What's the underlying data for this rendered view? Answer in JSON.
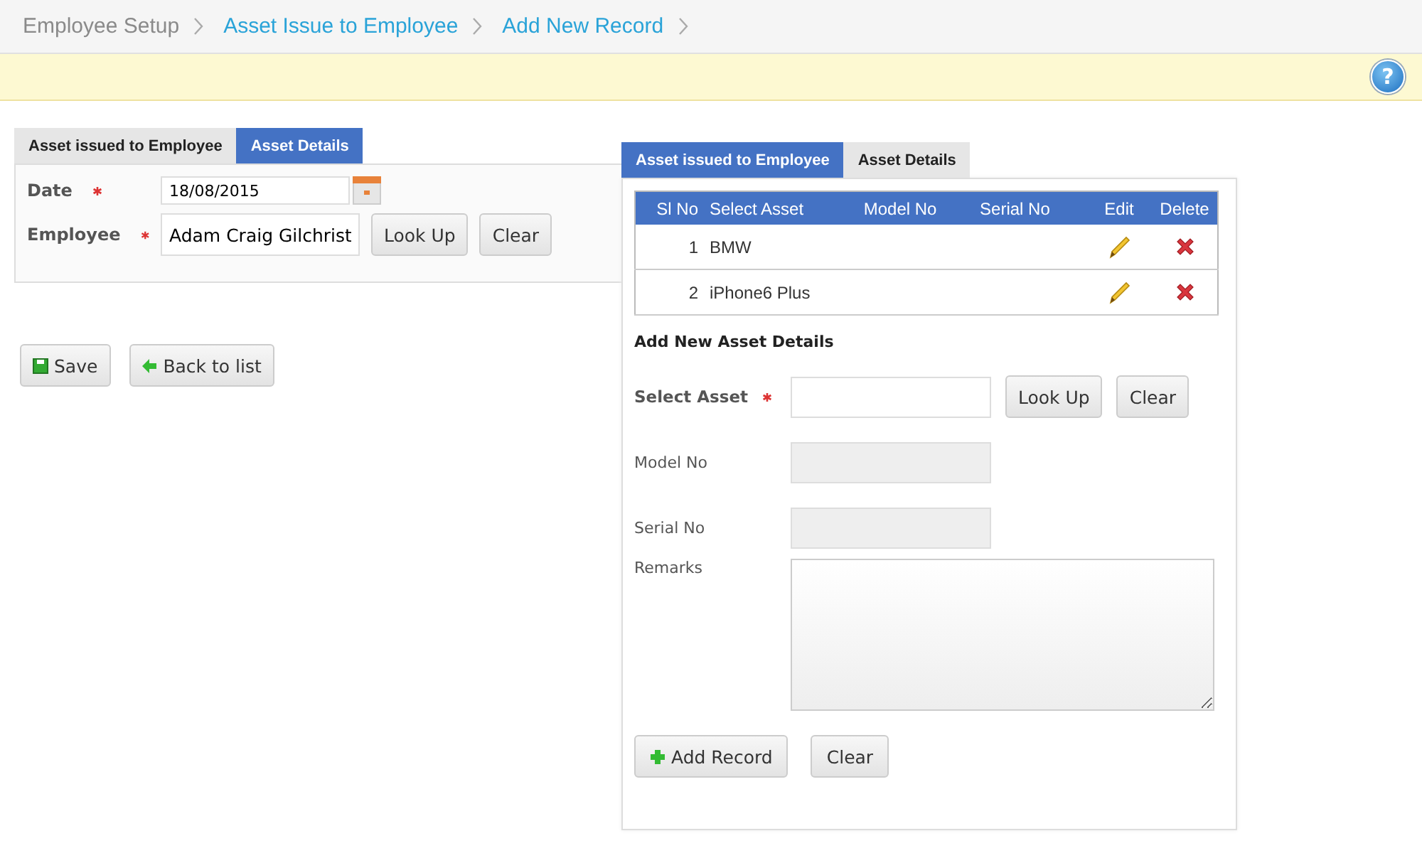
{
  "breadcrumb": [
    {
      "label": "Employee Setup",
      "current": false
    },
    {
      "label": "Asset Issue to Employee",
      "current": true
    },
    {
      "label": "Add New Record",
      "current": true
    }
  ],
  "help_icon": "?",
  "left_panel": {
    "tabs": [
      {
        "label": "Asset issued to Employee",
        "selected": false
      },
      {
        "label": "Asset Details",
        "selected": true
      }
    ],
    "fields": [
      {
        "label": "Date",
        "required": true,
        "value": "18/08/2015",
        "kind": "date"
      },
      {
        "label": "Employee",
        "required": true,
        "value": "Adam Craig Gilchrist",
        "kind": "lookup",
        "buttons": [
          "Look Up",
          "Clear"
        ]
      }
    ]
  },
  "actions": [
    {
      "label": "Save",
      "kind": "save"
    },
    {
      "label": "Back to list",
      "kind": "back"
    }
  ],
  "right_panel": {
    "tabs": [
      {
        "label": "Asset issued to Employee",
        "selected": true
      },
      {
        "label": "Asset Details",
        "selected": false
      }
    ],
    "table": {
      "columns": [
        "Sl No",
        "Select Asset",
        "Model No",
        "Serial No",
        "Edit",
        "Delete"
      ],
      "rows": [
        {
          "sl_no": "1",
          "asset": "BMW"
        },
        {
          "sl_no": "2",
          "asset": "iPhone6 Plus"
        }
      ]
    },
    "form_title": "Add New Asset Details",
    "fields": [
      {
        "label": "Select Asset",
        "required": true,
        "kind": "lookup",
        "buttons": [
          "Look Up",
          "Clear"
        ]
      },
      {
        "label": "Model No",
        "required": false,
        "kind": "readonly"
      },
      {
        "label": "Serial No",
        "required": false,
        "kind": "readonly"
      },
      {
        "label": "Remarks",
        "required": false,
        "kind": "textarea"
      }
    ],
    "buttons": [
      {
        "label": "Add Record",
        "kind": "add"
      },
      {
        "label": "Clear",
        "kind": "plain"
      }
    ]
  }
}
